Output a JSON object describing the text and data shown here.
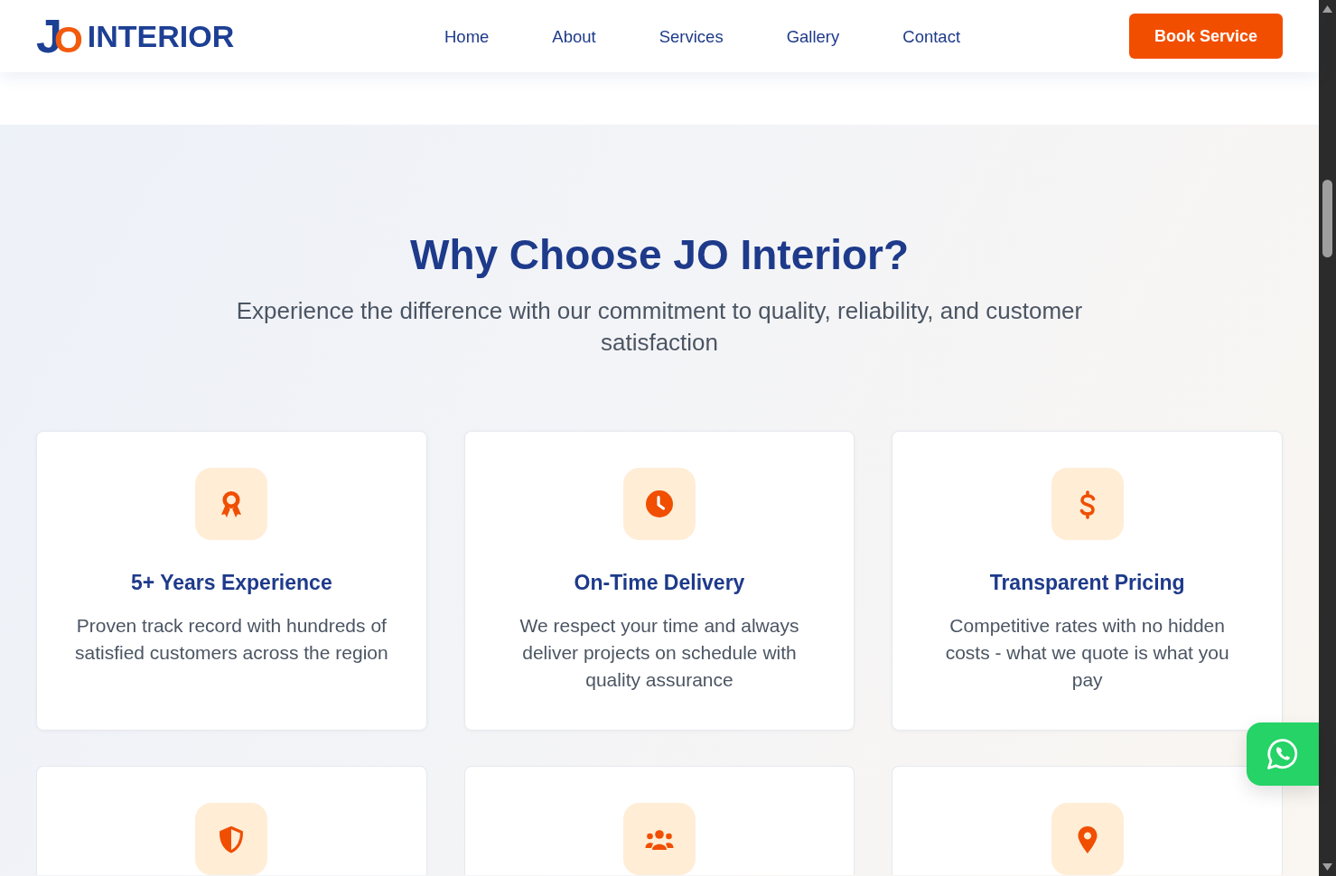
{
  "header": {
    "logo": {
      "mark": [
        "J",
        "O"
      ],
      "name": "INTERIOR"
    },
    "nav": [
      "Home",
      "About",
      "Services",
      "Gallery",
      "Contact"
    ],
    "cta": "Book Service"
  },
  "why_choose": {
    "title": "Why Choose JO Interior?",
    "subtitle": "Experience the difference with our commitment to quality, reliability, and customer satisfaction",
    "features": [
      {
        "kind": "full",
        "title": "5+ Years Experience",
        "description": "Proven track record with hundreds of satisfied customers across the region"
      },
      {
        "kind": "full",
        "title": "On-Time Delivery",
        "description": "We respect your time and always deliver projects on schedule with quality assurance"
      },
      {
        "kind": "full",
        "title": "Transparent Pricing",
        "description": "Competitive rates with no hidden costs - what we quote is what you pay"
      },
      {
        "kind": "cut_off"
      },
      {
        "kind": "cut_off"
      },
      {
        "kind": "cut_off"
      }
    ]
  }
}
